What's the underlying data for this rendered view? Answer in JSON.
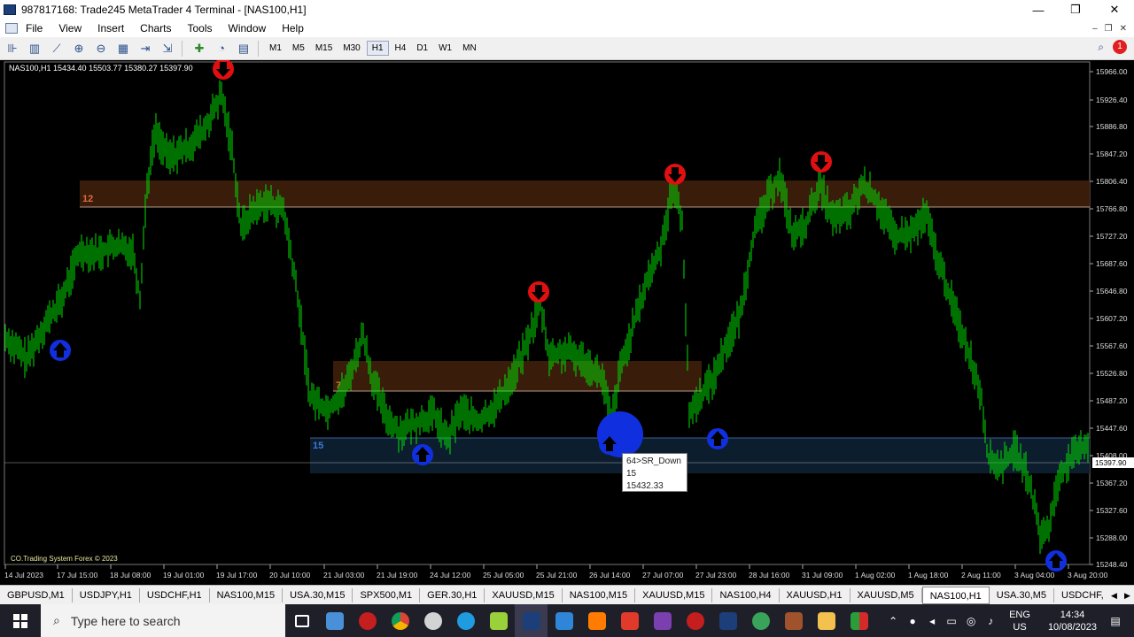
{
  "window": {
    "title": "987817168: Trade245 MetaTrader 4 Terminal - [NAS100,H1]",
    "minimize": "—",
    "restore": "❐",
    "close": "✕"
  },
  "menu": {
    "items": [
      "File",
      "View",
      "Insert",
      "Charts",
      "Tools",
      "Window",
      "Help"
    ],
    "mdi_min": "–",
    "mdi_restore": "❐",
    "mdi_close": "✕"
  },
  "toolbar": {
    "timeframes": [
      "M1",
      "M5",
      "M15",
      "M30",
      "H1",
      "H4",
      "D1",
      "W1",
      "MN"
    ],
    "active_timeframe": "H1",
    "alert_count": "1"
  },
  "chart": {
    "header": "NAS100,H1  15434.40 15503.77 15380.27 15397.90",
    "copyright": "CO.Trading System Forex © 2023",
    "current_price": "15397.90",
    "price_labels": [
      "15966.00",
      "15926.40",
      "15886.80",
      "15847.20",
      "15806.40",
      "15766.80",
      "15727.20",
      "15687.60",
      "15646.80",
      "15607.20",
      "15567.60",
      "15526.80",
      "15487.20",
      "15447.60",
      "15408.00",
      "15367.20",
      "15327.60",
      "15288.00",
      "15248.40"
    ],
    "time_labels": [
      "14 Jul 2023",
      "17 Jul 15:00",
      "18 Jul 08:00",
      "19 Jul 01:00",
      "19 Jul 17:00",
      "20 Jul 10:00",
      "21 Jul 03:00",
      "21 Jul 19:00",
      "24 Jul 12:00",
      "25 Jul 05:00",
      "25 Jul 21:00",
      "26 Jul 14:00",
      "27 Jul 07:00",
      "27 Jul 23:00",
      "28 Jul 16:00",
      "31 Jul 09:00",
      "1 Aug 02:00",
      "1 Aug 18:00",
      "2 Aug 11:00",
      "3 Aug 04:00",
      "3 Aug 20:00"
    ],
    "zones": [
      {
        "label": "12",
        "color": "#3a1c0a",
        "label_color": "#e06a3a"
      },
      {
        "label": "7",
        "color": "#3a1c0a",
        "label_color": "#e06a3a"
      },
      {
        "label": "15",
        "color": "#0c1e2e",
        "label_color": "#3a7ad8"
      }
    ],
    "tooltip": {
      "line1": "64>SR_Down",
      "line2": "15",
      "line3": "15432.33"
    },
    "candle_color": "#00e000",
    "down_arrow_color": "#e01010",
    "up_arrow_color": "#1030e0"
  },
  "symbol_tabs": [
    "GBPUSD,M1",
    "USDJPY,H1",
    "USDCHF,H1",
    "NAS100,M15",
    "USA.30,M15",
    "SPX500,M1",
    "GER.30,H1",
    "XAUUSD,M15",
    "NAS100,M15",
    "XAUUSD,M15",
    "NAS100,H4",
    "XAUUSD,H1",
    "XAUUSD,M5",
    "NAS100,H1",
    "USA.30,M5",
    "USDCHF,"
  ],
  "active_tab": "NAS100,H1",
  "taskbar": {
    "search_placeholder": "Type here to search",
    "lang_top": "ENG",
    "lang_bottom": "US",
    "time": "14:34",
    "date": "10/08/2023"
  }
}
